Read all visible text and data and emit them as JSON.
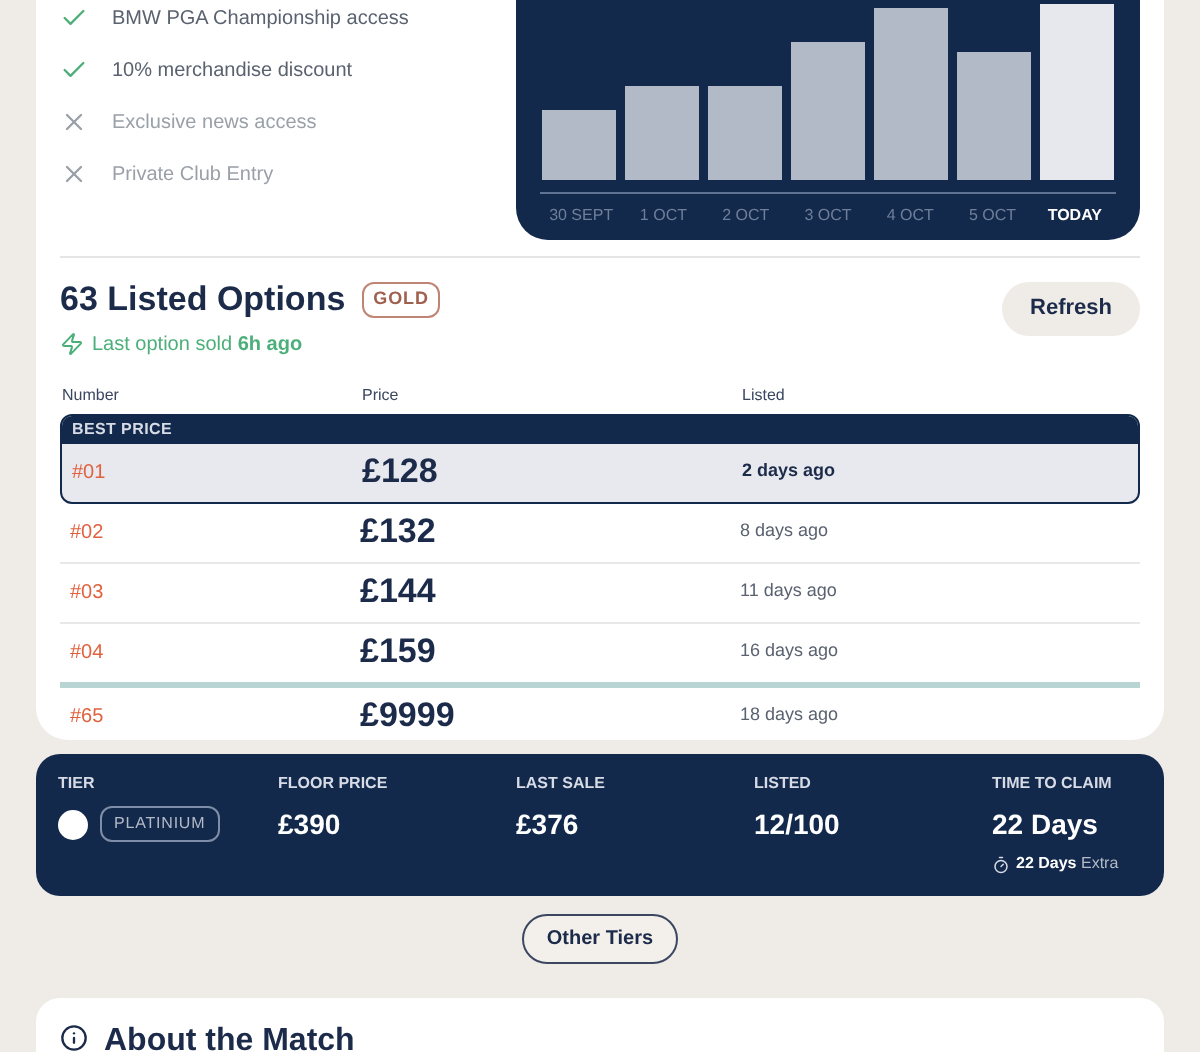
{
  "benefits": [
    {
      "label": "BMW PGA Championship access",
      "included": true
    },
    {
      "label": "10% merchandise discount",
      "included": true
    },
    {
      "label": "Exclusive news access",
      "included": false
    },
    {
      "label": "Private Club Entry",
      "included": false
    }
  ],
  "chart": {
    "categories": [
      {
        "label": "30 SEPT",
        "selected": false
      },
      {
        "label": "1 OCT",
        "selected": false
      },
      {
        "label": "2 OCT",
        "selected": false
      },
      {
        "label": "3 OCT",
        "selected": false
      },
      {
        "label": "4 OCT",
        "selected": false
      },
      {
        "label": "5 OCT",
        "selected": false
      },
      {
        "label": "TODAY",
        "selected": true
      }
    ]
  },
  "listings": {
    "count": "63",
    "title": "Listed Options",
    "badge": "GOLD",
    "last_sold_prefix": "Last option sold",
    "last_sold_time": "6h ago",
    "refresh": "Refresh",
    "columns": [
      "Number",
      "Price",
      "Listed"
    ],
    "best_label": "BEST PRICE",
    "rows": [
      {
        "number": "#01",
        "price": "£128",
        "listed": "2 days ago",
        "highlighted": true,
        "separated": false
      },
      {
        "number": "#02",
        "price": "£132",
        "listed": "8 days ago",
        "highlighted": false,
        "separated": false
      },
      {
        "number": "#03",
        "price": "£144",
        "listed": "11 days ago",
        "highlighted": false,
        "separated": false
      },
      {
        "number": "#04",
        "price": "£159",
        "listed": "16 days ago",
        "highlighted": false,
        "separated": false
      },
      {
        "number": "#65",
        "price": "£9999",
        "listed": "18 days ago",
        "highlighted": false,
        "separated": true
      }
    ]
  },
  "tier": {
    "tier_label": "TIER",
    "tier": "PLATINIUM",
    "stats": [
      {
        "label": "FLOOR PRICE",
        "value": "£390"
      },
      {
        "label": "LAST SALE",
        "value": "£376"
      },
      {
        "label": "LISTED",
        "value": "12/100"
      },
      {
        "label": "TIME TO CLAIM",
        "value": "22 Days"
      }
    ],
    "extra_bold": "22 Days",
    "extra": "Extra"
  },
  "other_tiers": "Other Tiers",
  "about": {
    "title": "About the Match"
  }
}
